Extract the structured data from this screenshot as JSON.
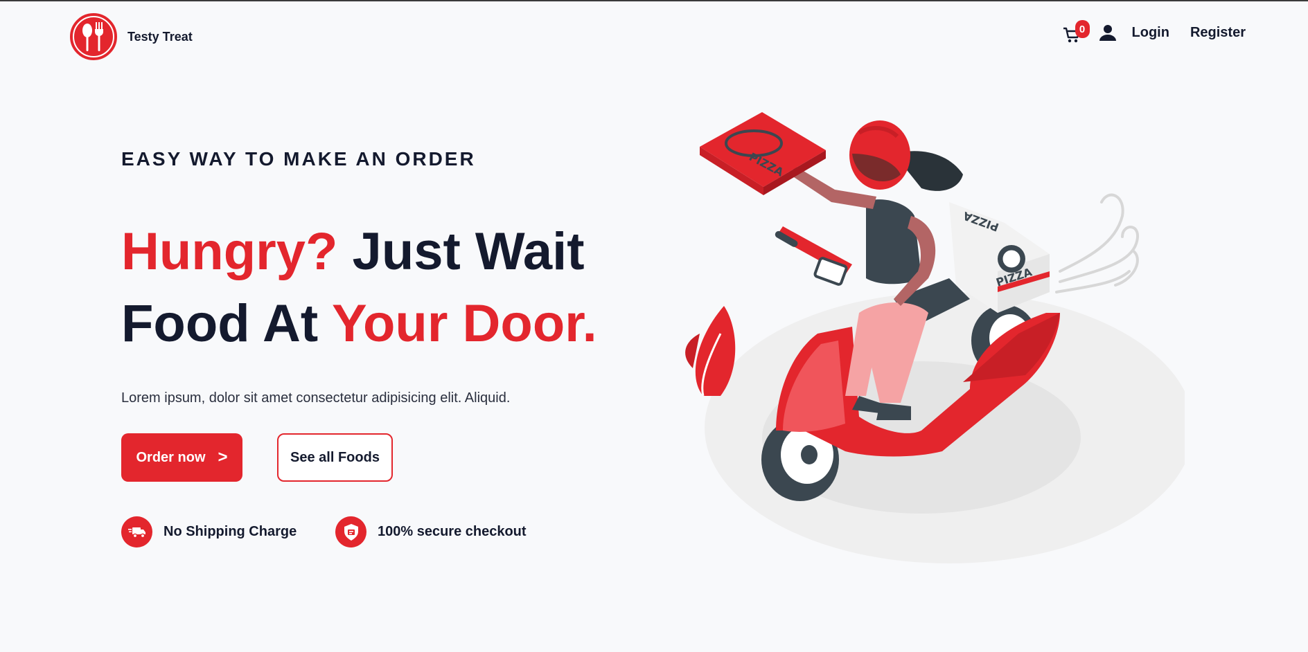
{
  "brand": {
    "name": "Testy Treat",
    "logo_icon": "spoon-fork-icon",
    "accent": "#e3262d",
    "dark": "#141a2e"
  },
  "nav": {
    "cart_icon": "cart-icon",
    "cart_count": "0",
    "user_icon": "user-icon",
    "login_label": "Login",
    "register_label": "Register"
  },
  "hero": {
    "eyebrow": "EASY WAY TO MAKE AN ORDER",
    "headline_part1": "Hungry?",
    "headline_part2": " Just Wait",
    "headline_part3": "Food At ",
    "headline_part4": "Your Door.",
    "description": "Lorem ipsum, dolor sit amet consectetur adipisicing elit. Aliquid.",
    "order_button": "Order now",
    "order_arrow": ">",
    "foods_button": "See all Foods"
  },
  "features": [
    {
      "icon": "delivery-truck-icon",
      "label": "No Shipping Charge"
    },
    {
      "icon": "secure-shield-icon",
      "label": "100% secure checkout"
    }
  ],
  "illustration": {
    "icon": "scooter-pizza-delivery-illustration",
    "box_text": "PIZZA"
  }
}
